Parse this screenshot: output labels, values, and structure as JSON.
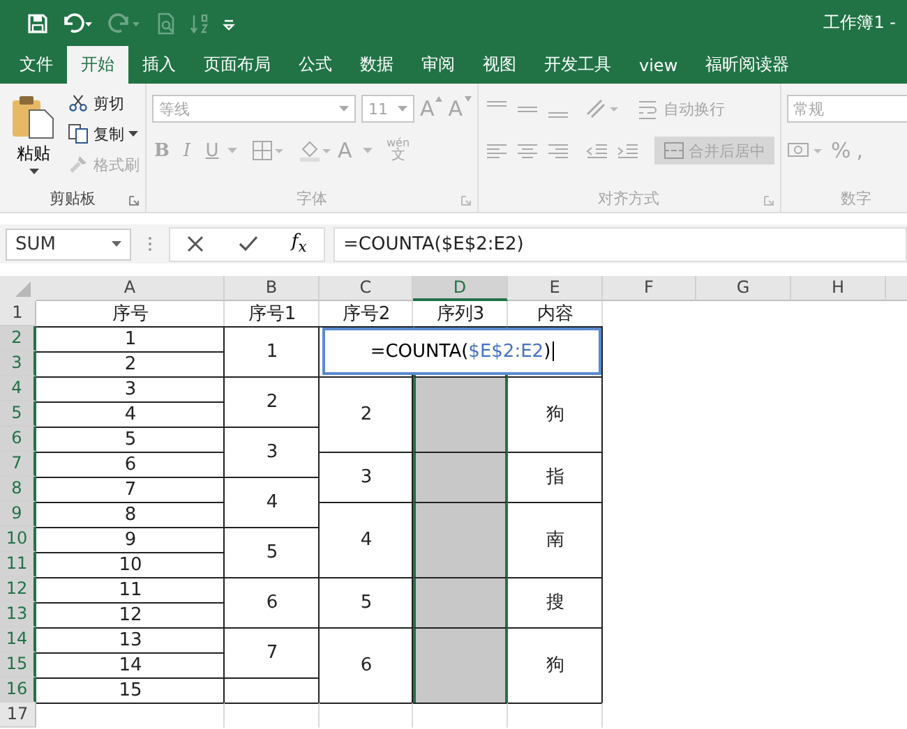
{
  "window": {
    "title": "工作簿1 -"
  },
  "tabs": [
    {
      "label": "文件",
      "selected": false
    },
    {
      "label": "开始",
      "selected": true
    },
    {
      "label": "插入",
      "selected": false
    },
    {
      "label": "页面布局",
      "selected": false
    },
    {
      "label": "公式",
      "selected": false
    },
    {
      "label": "数据",
      "selected": false
    },
    {
      "label": "审阅",
      "selected": false
    },
    {
      "label": "视图",
      "selected": false
    },
    {
      "label": "开发工具",
      "selected": false
    },
    {
      "label": "view",
      "selected": false
    },
    {
      "label": "福昕阅读器",
      "selected": false
    }
  ],
  "ribbon": {
    "clipboard": {
      "label": "剪贴板",
      "paste": "粘贴",
      "cut": {
        "label": "剪切",
        "disabled": false
      },
      "copy": {
        "label": "复制",
        "disabled": false
      },
      "format_painter": {
        "label": "格式刷",
        "disabled": true
      }
    },
    "font": {
      "label": "字体",
      "disabled": true,
      "font_name": "等线",
      "font_size": "11",
      "grow": "A",
      "shrink": "A",
      "bold": "B",
      "italic": "I",
      "underline": "U",
      "font_color": "A",
      "phonetic_top": "wén",
      "phonetic_bottom": "文"
    },
    "alignment": {
      "label": "对齐方式",
      "disabled": true,
      "wrap_text": "自动换行",
      "merge_center": "合并后居中"
    },
    "number": {
      "label": "数字",
      "disabled": true,
      "format": "常规",
      "percent": "%",
      "comma": ","
    }
  },
  "formula_bar": {
    "name_box": "SUM",
    "fx": "f$_{x}$",
    "formula": "=COUNTA($E$2:E2)"
  },
  "sheet": {
    "columns": [
      {
        "label": "A",
        "selected": false,
        "cells": [
          {
            "text": "序号",
            "merged": false,
            "bordered": false,
            "shaded": false
          },
          {
            "text": "1",
            "merged": false,
            "bordered": true,
            "shaded": false
          },
          {
            "text": "2",
            "merged": false,
            "bordered": true,
            "shaded": false
          },
          {
            "text": "3",
            "merged": false,
            "bordered": true,
            "shaded": false
          },
          {
            "text": "4",
            "merged": false,
            "bordered": true,
            "shaded": false
          },
          {
            "text": "5",
            "merged": false,
            "bordered": true,
            "shaded": false
          },
          {
            "text": "6",
            "merged": false,
            "bordered": true,
            "shaded": false
          },
          {
            "text": "7",
            "merged": false,
            "bordered": true,
            "shaded": false
          },
          {
            "text": "8",
            "merged": false,
            "bordered": true,
            "shaded": false
          },
          {
            "text": "9",
            "merged": false,
            "bordered": true,
            "shaded": false
          },
          {
            "text": "10",
            "merged": false,
            "bordered": true,
            "shaded": false
          },
          {
            "text": "11",
            "merged": false,
            "bordered": true,
            "shaded": false
          },
          {
            "text": "12",
            "merged": false,
            "bordered": true,
            "shaded": false
          },
          {
            "text": "13",
            "merged": false,
            "bordered": true,
            "shaded": false
          },
          {
            "text": "14",
            "merged": false,
            "bordered": true,
            "shaded": false
          },
          {
            "text": "15",
            "merged": false,
            "bordered": true,
            "shaded": false
          },
          {
            "merged": false,
            "bordered": false,
            "shaded": false
          }
        ]
      },
      {
        "label": "B",
        "selected": false,
        "cells": [
          {
            "text": "序号1",
            "merged": false,
            "bordered": false,
            "shaded": false
          },
          {
            "text": "1",
            "merged": false,
            "bordered": true,
            "shaded": false
          },
          {
            "merged": true
          },
          {
            "text": "2",
            "merged": false,
            "bordered": true,
            "shaded": false
          },
          {
            "merged": true
          },
          {
            "text": "3",
            "merged": false,
            "bordered": true,
            "shaded": false
          },
          {
            "merged": true
          },
          {
            "text": "4",
            "merged": false,
            "bordered": true,
            "shaded": false
          },
          {
            "merged": true
          },
          {
            "text": "5",
            "merged": false,
            "bordered": true,
            "shaded": false
          },
          {
            "merged": true
          },
          {
            "text": "6",
            "merged": false,
            "bordered": true,
            "shaded": false
          },
          {
            "merged": true
          },
          {
            "text": "7",
            "merged": false,
            "bordered": true,
            "shaded": false
          },
          {
            "merged": true
          },
          {
            "merged": false,
            "bordered": true,
            "shaded": false
          },
          {
            "merged": false,
            "bordered": false,
            "shaded": false
          }
        ]
      },
      {
        "label": "C",
        "selected": false,
        "cells": [
          {
            "text": "序号2",
            "merged": false,
            "bordered": false,
            "shaded": false
          },
          {
            "merged": false,
            "bordered": true,
            "shaded": false
          },
          {
            "merged": true
          },
          {
            "text": "2",
            "merged": false,
            "bordered": true,
            "shaded": false
          },
          {
            "merged": true
          },
          {
            "merged": true
          },
          {
            "text": "3",
            "merged": false,
            "bordered": true,
            "shaded": false
          },
          {
            "merged": true
          },
          {
            "text": "4",
            "merged": false,
            "bordered": true,
            "shaded": false
          },
          {
            "merged": true
          },
          {
            "merged": true
          },
          {
            "text": "5",
            "merged": false,
            "bordered": true,
            "shaded": false
          },
          {
            "merged": true
          },
          {
            "text": "6",
            "merged": false,
            "bordered": true,
            "shaded": false
          },
          {
            "merged": true
          },
          {
            "merged": true
          },
          {
            "merged": false,
            "bordered": false,
            "shaded": false
          }
        ]
      },
      {
        "label": "D",
        "selected": true,
        "cells": [
          {
            "text": "序列3",
            "merged": false,
            "bordered": false,
            "shaded": false
          },
          {
            "merged": false,
            "bordered": true,
            "shaded": false
          },
          {
            "merged": true
          },
          {
            "merged": false,
            "bordered": true,
            "shaded": true
          },
          {
            "merged": true
          },
          {
            "merged": true
          },
          {
            "merged": false,
            "bordered": true,
            "shaded": true
          },
          {
            "merged": true
          },
          {
            "merged": false,
            "bordered": true,
            "shaded": true
          },
          {
            "merged": true
          },
          {
            "merged": true
          },
          {
            "merged": false,
            "bordered": true,
            "shaded": true
          },
          {
            "merged": true
          },
          {
            "merged": false,
            "bordered": true,
            "shaded": true
          },
          {
            "merged": true
          },
          {
            "merged": true
          },
          {
            "merged": false,
            "bordered": false,
            "shaded": false
          }
        ]
      },
      {
        "label": "E",
        "selected": false,
        "cells": [
          {
            "text": "内容",
            "merged": false,
            "bordered": false,
            "shaded": false
          },
          {
            "merged": false,
            "bordered": true,
            "shaded": false
          },
          {
            "merged": true
          },
          {
            "text": "狗",
            "merged": false,
            "bordered": true,
            "shaded": false
          },
          {
            "merged": true
          },
          {
            "merged": true
          },
          {
            "text": "指",
            "merged": false,
            "bordered": true,
            "shaded": false
          },
          {
            "merged": true
          },
          {
            "text": "南",
            "merged": false,
            "bordered": true,
            "shaded": false
          },
          {
            "merged": true
          },
          {
            "merged": true
          },
          {
            "text": "搜",
            "merged": false,
            "bordered": true,
            "shaded": false
          },
          {
            "merged": true
          },
          {
            "text": "狗",
            "merged": false,
            "bordered": true,
            "shaded": false
          },
          {
            "merged": true
          },
          {
            "merged": true
          },
          {
            "merged": false,
            "bordered": false,
            "shaded": false
          }
        ]
      },
      {
        "label": "F",
        "selected": false
      },
      {
        "label": "G",
        "selected": false
      },
      {
        "label": "H",
        "selected": false
      }
    ],
    "rows": [
      {
        "label": "1",
        "selected": false
      },
      {
        "label": "2",
        "selected": true
      },
      {
        "label": "3",
        "selected": true
      },
      {
        "label": "4",
        "selected": true
      },
      {
        "label": "5",
        "selected": true
      },
      {
        "label": "6",
        "selected": true
      },
      {
        "label": "7",
        "selected": true
      },
      {
        "label": "8",
        "selected": true
      },
      {
        "label": "9",
        "selected": true
      },
      {
        "label": "10",
        "selected": true
      },
      {
        "label": "11",
        "selected": true
      },
      {
        "label": "12",
        "selected": true
      },
      {
        "label": "13",
        "selected": true
      },
      {
        "label": "14",
        "selected": true
      },
      {
        "label": "15",
        "selected": true
      },
      {
        "label": "16",
        "selected": true
      },
      {
        "label": "17",
        "selected": false
      }
    ],
    "editor": {
      "parts": [
        {
          "text": "=COUNTA(",
          "kind": "plain"
        },
        {
          "text": "$E$2:E2",
          "kind": "reference"
        },
        {
          "text": ")",
          "kind": "plain"
        }
      ]
    }
  }
}
